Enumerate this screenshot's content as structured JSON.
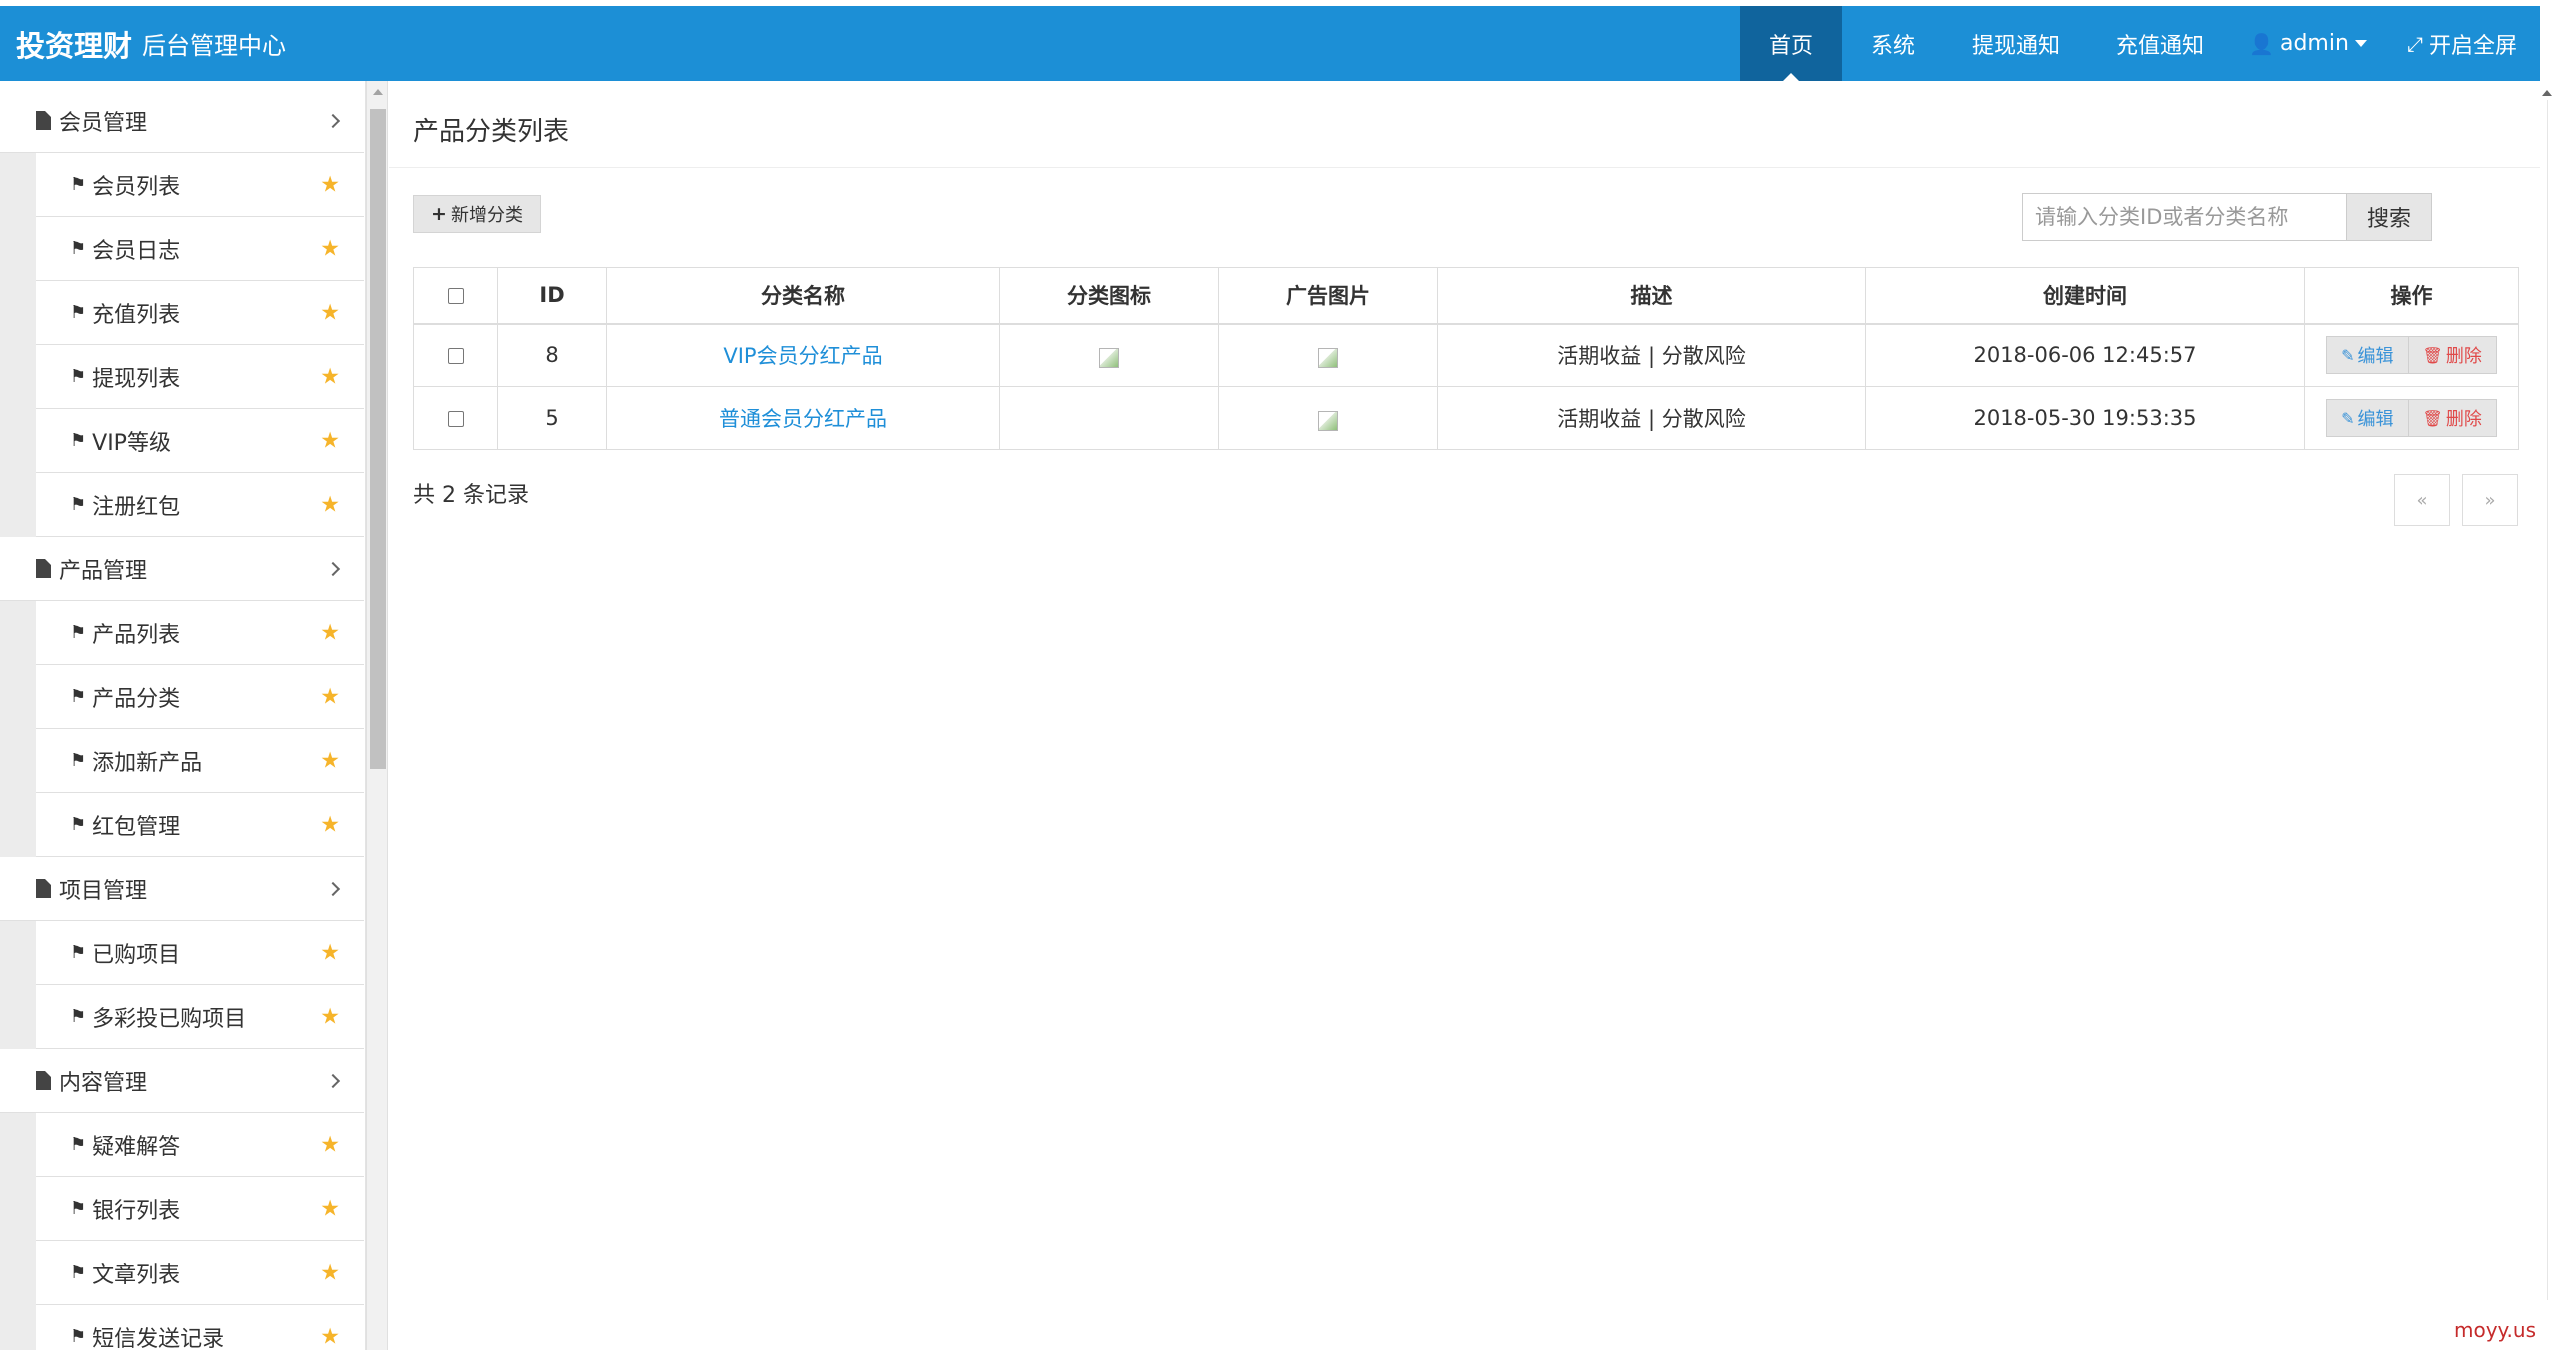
{
  "header": {
    "brand_main": "投资理财",
    "brand_sub": "后台管理中心",
    "nav": [
      {
        "label": "首页",
        "active": true
      },
      {
        "label": "系统"
      },
      {
        "label": "提现通知"
      },
      {
        "label": "充值通知"
      },
      {
        "label": "admin",
        "icon": "user-icon"
      },
      {
        "label": "开启全屏",
        "icon": "fullscreen-icon"
      }
    ]
  },
  "sidebar": {
    "groups": [
      {
        "label": "会员管理",
        "items": [
          "会员列表",
          "会员日志",
          "充值列表",
          "提现列表",
          "VIP等级",
          "注册红包"
        ]
      },
      {
        "label": "产品管理",
        "items": [
          "产品列表",
          "产品分类",
          "添加新产品",
          "红包管理"
        ]
      },
      {
        "label": "项目管理",
        "items": [
          "已购项目",
          "多彩投已购项目"
        ]
      },
      {
        "label": "内容管理",
        "items": [
          "疑难解答",
          "银行列表",
          "文章列表",
          "短信发送记录"
        ]
      }
    ]
  },
  "main": {
    "title": "产品分类列表",
    "add_button": "新增分类",
    "search_placeholder": "请输入分类ID或者分类名称",
    "search_button": "搜索",
    "columns": [
      "ID",
      "分类名称",
      "分类图标",
      "广告图片",
      "描述",
      "创建时间",
      "操作"
    ],
    "rows": [
      {
        "id": "8",
        "name": "VIP会员分红产品",
        "has_icon": true,
        "has_ad": true,
        "desc": "活期收益 | 分散风险",
        "created": "2018-06-06 12:45:57"
      },
      {
        "id": "5",
        "name": "普通会员分红产品",
        "has_icon": false,
        "has_ad": true,
        "desc": "活期收益 | 分散风险",
        "created": "2018-05-30 19:53:35"
      }
    ],
    "edit_label": "编辑",
    "delete_label": "删除",
    "record_count": "共 2 条记录",
    "pager_prev": "«",
    "pager_next": "»"
  },
  "watermark": "moyy.us",
  "colors": {
    "header_bg": "#1c8fd6",
    "nav_active_bg": "#10649d",
    "link": "#1f8fd8",
    "star": "#f6b42a",
    "delete": "#e04a4a"
  }
}
